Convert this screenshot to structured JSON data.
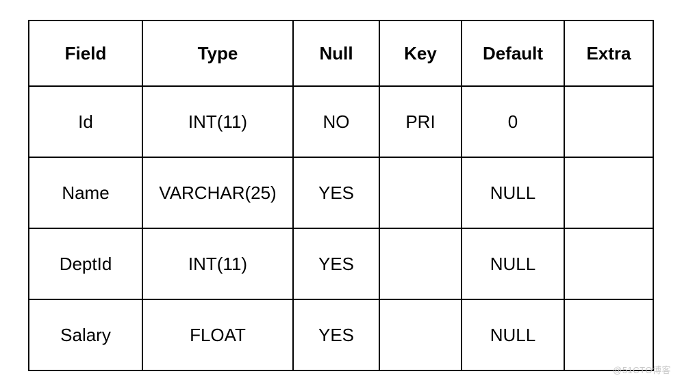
{
  "chart_data": {
    "type": "table",
    "columns": [
      "Field",
      "Type",
      "Null",
      "Key",
      "Default",
      "Extra"
    ],
    "rows": [
      [
        "Id",
        "INT(11)",
        "NO",
        "PRI",
        "0",
        ""
      ],
      [
        "Name",
        "VARCHAR(25)",
        "YES",
        "",
        "NULL",
        ""
      ],
      [
        "DeptId",
        "INT(11)",
        "YES",
        "",
        "NULL",
        ""
      ],
      [
        "Salary",
        "FLOAT",
        "YES",
        "",
        "NULL",
        ""
      ]
    ]
  },
  "headers": {
    "field": "Field",
    "type": "Type",
    "null": "Null",
    "key": "Key",
    "default": "Default",
    "extra": "Extra"
  },
  "rows": [
    {
      "field": "Id",
      "type": "INT(11)",
      "null": "NO",
      "key": "PRI",
      "default": "0",
      "extra": ""
    },
    {
      "field": "Name",
      "type": "VARCHAR(25)",
      "null": "YES",
      "key": "",
      "default": "NULL",
      "extra": ""
    },
    {
      "field": "DeptId",
      "type": "INT(11)",
      "null": "YES",
      "key": "",
      "default": "NULL",
      "extra": ""
    },
    {
      "field": "Salary",
      "type": "FLOAT",
      "null": "YES",
      "key": "",
      "default": "NULL",
      "extra": ""
    }
  ],
  "watermark": "@51CTO博客"
}
